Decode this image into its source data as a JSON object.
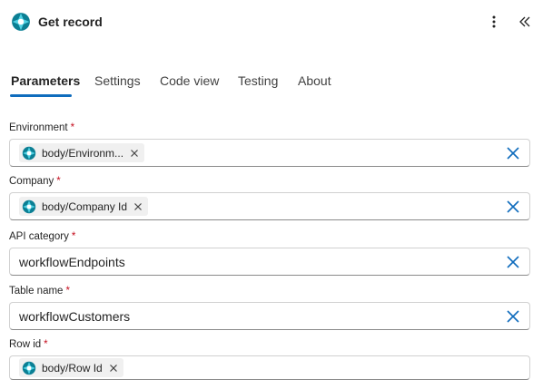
{
  "header": {
    "title": "Get record",
    "app_icon": "dataverse-icon",
    "more_icon": "more-vertical-icon",
    "collapse_icon": "double-chevron-left-icon"
  },
  "tabs": [
    {
      "label": "Parameters",
      "active": true
    },
    {
      "label": "Settings",
      "active": false
    },
    {
      "label": "Code view",
      "active": false
    },
    {
      "label": "Testing",
      "active": false
    },
    {
      "label": "About",
      "active": false
    }
  ],
  "fields": {
    "environment": {
      "label": "Environment",
      "required": "*",
      "token": "body/Environm..."
    },
    "company": {
      "label": "Company",
      "required": "*",
      "token": "body/Company Id"
    },
    "api_category": {
      "label": "API category",
      "required": "*",
      "value": "workflowEndpoints"
    },
    "table_name": {
      "label": "Table name",
      "required": "*",
      "value": "workflowCustomers"
    },
    "row_id": {
      "label": "Row id",
      "required": "*",
      "token": "body/Row Id"
    }
  },
  "colors": {
    "accent": "#0f6cbd",
    "required": "#c50f1f",
    "token_icon_teal": "#0a8fa3"
  }
}
